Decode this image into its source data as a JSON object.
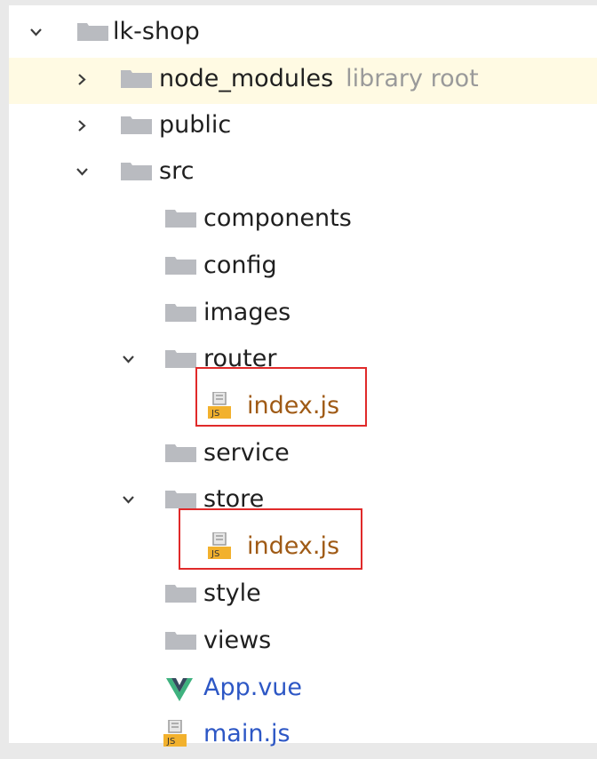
{
  "tree": {
    "root": {
      "label": "lk-shop"
    },
    "node_modules": {
      "label": "node_modules",
      "hint": "library root"
    },
    "public": {
      "label": "public"
    },
    "src": {
      "label": "src"
    },
    "components": {
      "label": "components"
    },
    "config": {
      "label": "config"
    },
    "images": {
      "label": "images"
    },
    "router": {
      "label": "router"
    },
    "router_index": {
      "label": "index.js"
    },
    "service": {
      "label": "service"
    },
    "store": {
      "label": "store"
    },
    "store_index": {
      "label": "index.js"
    },
    "style": {
      "label": "style"
    },
    "views": {
      "label": "views"
    },
    "app_vue": {
      "label": "App.vue"
    },
    "main_js": {
      "label": "main.js"
    }
  },
  "icons": {
    "folder": "folder-icon",
    "js_file": "js-file-icon",
    "vue_file": "vue-icon",
    "expanded": "chevron-down-icon",
    "collapsed": "chevron-right-icon"
  },
  "colors": {
    "highlight_row": "#fffae3",
    "selection_box": "#e02a2a",
    "js_text": "#9f5a15",
    "vue_text": "#2d57c5",
    "folder": "#b9bbc0"
  }
}
